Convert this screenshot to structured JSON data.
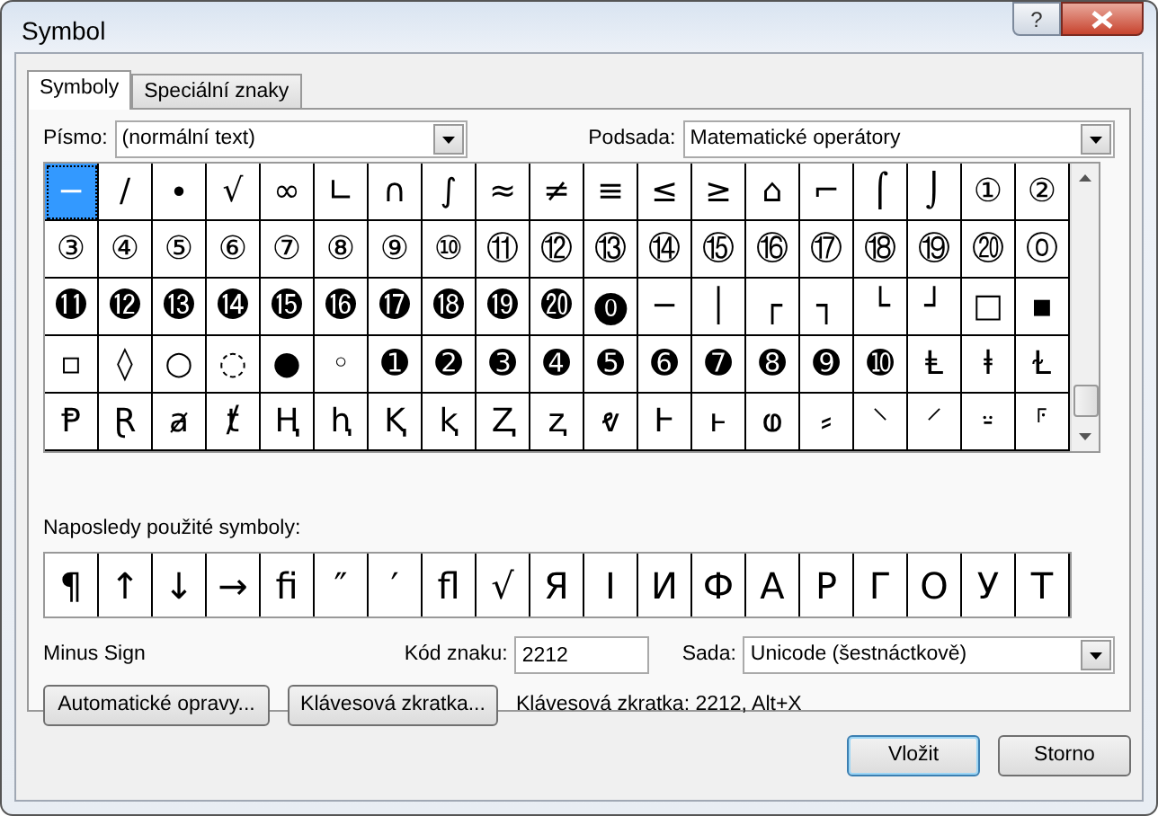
{
  "window": {
    "title": "Symbol",
    "help_label": "?"
  },
  "tabs": [
    {
      "label": "Symboly",
      "selected": true
    },
    {
      "label": "Speciální znaky",
      "selected": false
    }
  ],
  "font_field": {
    "label": "Písmo:",
    "value": "(normální text)"
  },
  "subset_field": {
    "label": "Podsada:",
    "value": "Matematické operátory"
  },
  "symbol_grid": {
    "cells": [
      {
        "char": "−",
        "selected": true
      },
      {
        "char": "∕",
        "selected": false
      },
      {
        "char": "∙",
        "selected": false
      },
      {
        "char": "√",
        "selected": false
      },
      {
        "char": "∞",
        "selected": false
      },
      {
        "char": "∟",
        "selected": false
      },
      {
        "char": "∩",
        "selected": false
      },
      {
        "char": "∫",
        "selected": false
      },
      {
        "char": "≈",
        "selected": false
      },
      {
        "char": "≠",
        "selected": false
      },
      {
        "char": "≡",
        "selected": false
      },
      {
        "char": "≤",
        "selected": false
      },
      {
        "char": "≥",
        "selected": false
      },
      {
        "char": "⌂",
        "selected": false
      },
      {
        "char": "⌐",
        "selected": false
      },
      {
        "char": "⌠",
        "selected": false
      },
      {
        "char": "⌡",
        "selected": false
      },
      {
        "char": "①",
        "selected": false
      },
      {
        "char": "②",
        "selected": false
      },
      {
        "char": "③",
        "selected": false
      },
      {
        "char": "④",
        "selected": false
      },
      {
        "char": "⑤",
        "selected": false
      },
      {
        "char": "⑥",
        "selected": false
      },
      {
        "char": "⑦",
        "selected": false
      },
      {
        "char": "⑧",
        "selected": false
      },
      {
        "char": "⑨",
        "selected": false
      },
      {
        "char": "⑩",
        "selected": false
      },
      {
        "char": "⑪",
        "selected": false
      },
      {
        "char": "⑫",
        "selected": false
      },
      {
        "char": "⑬",
        "selected": false
      },
      {
        "char": "⑭",
        "selected": false
      },
      {
        "char": "⑮",
        "selected": false
      },
      {
        "char": "⑯",
        "selected": false
      },
      {
        "char": "⑰",
        "selected": false
      },
      {
        "char": "⑱",
        "selected": false
      },
      {
        "char": "⑲",
        "selected": false
      },
      {
        "char": "⑳",
        "selected": false
      },
      {
        "char": "⓪",
        "selected": false
      },
      {
        "char": "⓫",
        "selected": false
      },
      {
        "char": "⓬",
        "selected": false
      },
      {
        "char": "⓭",
        "selected": false
      },
      {
        "char": "⓮",
        "selected": false
      },
      {
        "char": "⓯",
        "selected": false
      },
      {
        "char": "⓰",
        "selected": false
      },
      {
        "char": "⓱",
        "selected": false
      },
      {
        "char": "⓲",
        "selected": false
      },
      {
        "char": "⓳",
        "selected": false
      },
      {
        "char": "⓴",
        "selected": false
      },
      {
        "char": "⓿",
        "selected": false
      },
      {
        "char": "─",
        "selected": false
      },
      {
        "char": "│",
        "selected": false
      },
      {
        "char": "┌",
        "selected": false
      },
      {
        "char": "┐",
        "selected": false
      },
      {
        "char": "└",
        "selected": false
      },
      {
        "char": "┘",
        "selected": false
      },
      {
        "char": "□",
        "selected": false
      },
      {
        "char": "▪",
        "selected": false
      },
      {
        "char": "▫",
        "selected": false
      },
      {
        "char": "◊",
        "selected": false
      },
      {
        "char": "○",
        "selected": false
      },
      {
        "char": "◌",
        "selected": false
      },
      {
        "char": "●",
        "selected": false
      },
      {
        "char": "◦",
        "selected": false
      },
      {
        "char": "➊",
        "selected": false
      },
      {
        "char": "➋",
        "selected": false
      },
      {
        "char": "➌",
        "selected": false
      },
      {
        "char": "➍",
        "selected": false
      },
      {
        "char": "➎",
        "selected": false
      },
      {
        "char": "➏",
        "selected": false
      },
      {
        "char": "➐",
        "selected": false
      },
      {
        "char": "➑",
        "selected": false
      },
      {
        "char": "➒",
        "selected": false
      },
      {
        "char": "➓",
        "selected": false
      },
      {
        "char": "Ⱡ",
        "selected": false
      },
      {
        "char": "ⱡ",
        "selected": false
      },
      {
        "char": "Ɫ",
        "selected": false
      },
      {
        "char": "Ᵽ",
        "selected": false
      },
      {
        "char": "Ɽ",
        "selected": false
      },
      {
        "char": "ⱥ",
        "selected": false
      },
      {
        "char": "ⱦ",
        "selected": false
      },
      {
        "char": "Ⱨ",
        "selected": false
      },
      {
        "char": "ⱨ",
        "selected": false
      },
      {
        "char": "Ⱪ",
        "selected": false
      },
      {
        "char": "ⱪ",
        "selected": false
      },
      {
        "char": "Ⱬ",
        "selected": false
      },
      {
        "char": "ⱬ",
        "selected": false
      },
      {
        "char": "ⱴ",
        "selected": false
      },
      {
        "char": "Ⱶ",
        "selected": false
      },
      {
        "char": "ⱶ",
        "selected": false
      },
      {
        "char": "ⱷ",
        "selected": false
      },
      {
        "char": "⸗",
        "selected": false
      },
      {
        "char": "⸌",
        "selected": false
      },
      {
        "char": "⸍",
        "selected": false
      },
      {
        "char": "⸚",
        "selected": false
      },
      {
        "char": "⸁",
        "selected": false
      }
    ]
  },
  "recent": {
    "label": "Naposledy použité symboly:",
    "symbols": [
      "¶",
      "↑",
      "↓",
      "→",
      "ﬁ",
      "″",
      "′",
      "ﬂ",
      "√",
      "Я",
      "І",
      "И",
      "Ф",
      "А",
      "Р",
      "Г",
      "О",
      "У",
      "Т"
    ]
  },
  "char_name": "Minus Sign",
  "code_field": {
    "label": "Kód znaku:",
    "value": "2212"
  },
  "charset_field": {
    "label": "Sada:",
    "value": "Unicode (šestnáctkově)"
  },
  "autocorrect_button": "Automatické opravy...",
  "shortcut_button": "Klávesová zkratka...",
  "shortcut_text": "Klávesová zkratka: 2212, Alt+X",
  "dialog_buttons": [
    {
      "label": "Vložit",
      "default": true
    },
    {
      "label": "Storno",
      "default": false
    }
  ]
}
